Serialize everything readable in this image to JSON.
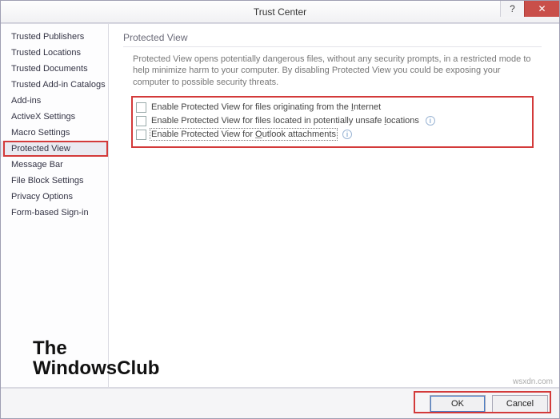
{
  "window": {
    "title": "Trust Center"
  },
  "sidebar": {
    "items": [
      {
        "label": "Trusted Publishers"
      },
      {
        "label": "Trusted Locations"
      },
      {
        "label": "Trusted Documents"
      },
      {
        "label": "Trusted Add-in Catalogs"
      },
      {
        "label": "Add-ins"
      },
      {
        "label": "ActiveX Settings"
      },
      {
        "label": "Macro Settings"
      },
      {
        "label": "Protected View"
      },
      {
        "label": "Message Bar"
      },
      {
        "label": "File Block Settings"
      },
      {
        "label": "Privacy Options"
      },
      {
        "label": "Form-based Sign-in"
      }
    ],
    "selected_index": 7
  },
  "content": {
    "section_title": "Protected View",
    "description": "Protected View opens potentially dangerous files, without any security prompts, in a restricted mode to help minimize harm to your computer. By disabling Protected View you could be exposing your computer to possible security threats.",
    "checkboxes": [
      {
        "label_pre": "Enable Protected View for files originating from the ",
        "label_u": "I",
        "label_post": "nternet"
      },
      {
        "label_pre": "Enable Protected View for files located in potentially unsafe ",
        "label_u": "l",
        "label_post": "ocations",
        "info": "i"
      },
      {
        "label_pre": "Enable Protected View for ",
        "label_u": "O",
        "label_post": "utlook attachments",
        "info": "i",
        "focused": true
      }
    ]
  },
  "footer": {
    "ok_label": "OK",
    "cancel_label": "Cancel"
  },
  "watermark": {
    "line1": "The",
    "line2": "WindowsClub"
  },
  "source_mark": "wsxdn.com",
  "glyphs": {
    "help": "?",
    "close": "✕"
  }
}
